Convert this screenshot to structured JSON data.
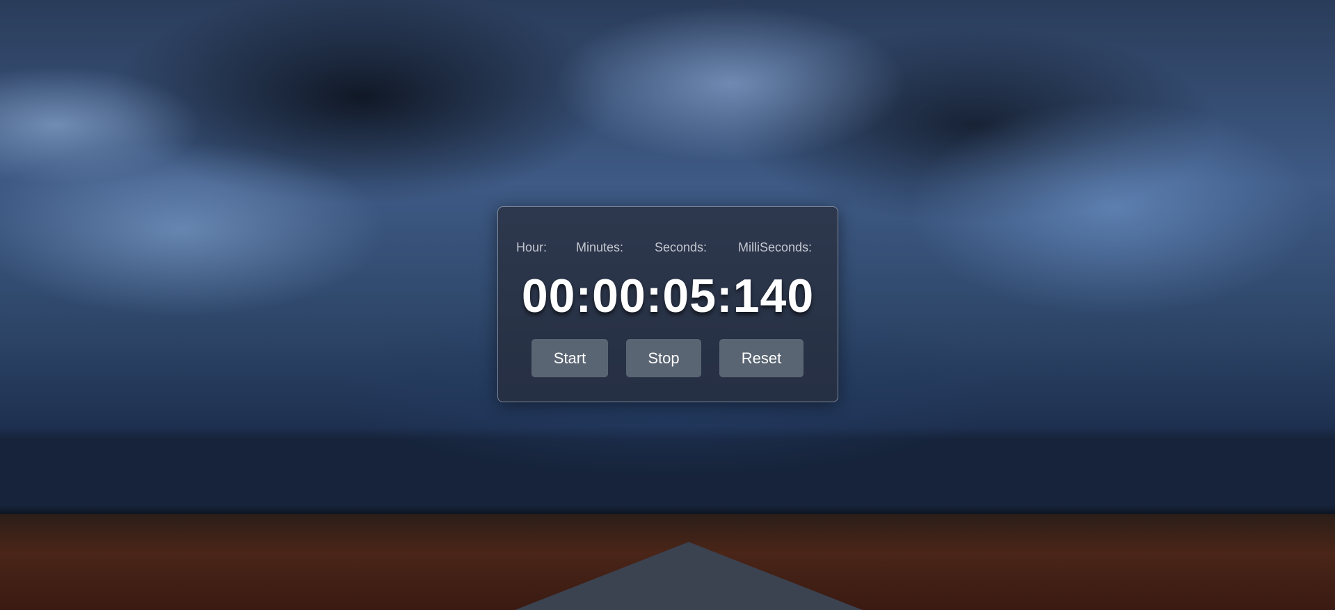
{
  "stopwatch": {
    "labels": {
      "hour": "Hour:",
      "minutes": "Minutes:",
      "seconds": "Seconds:",
      "milliseconds": "MilliSeconds:"
    },
    "display": "00:00:05:140",
    "buttons": {
      "start": "Start",
      "stop": "Stop",
      "reset": "Reset"
    }
  },
  "colors": {
    "button_bg": "#5a6573",
    "label_text": "#c4c8d0",
    "time_text": "#ffffff"
  }
}
